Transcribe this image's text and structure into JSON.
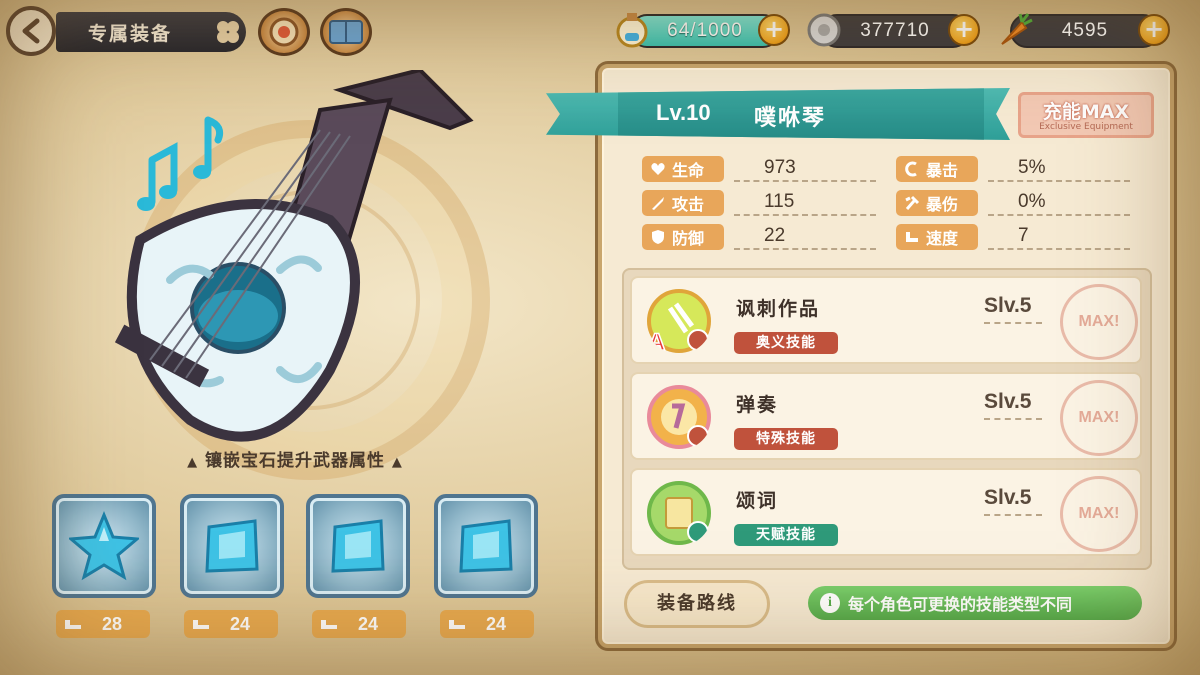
{
  "header": {
    "title": "专属装备",
    "resources": {
      "energy": "64/1000",
      "coins": "377710",
      "carrots": "4595"
    }
  },
  "weapon": {
    "level": "Lv.10",
    "name": "噗咻琴",
    "max_badge": "充能MAX",
    "max_badge_sub": "Exclusive Equipment",
    "gem_caption": "镶嵌宝石提升武器属性",
    "gems": [
      {
        "count": "28"
      },
      {
        "count": "24"
      },
      {
        "count": "24"
      },
      {
        "count": "24"
      }
    ]
  },
  "stats": {
    "hp": {
      "label": "生命",
      "value": "973"
    },
    "atk": {
      "label": "攻击",
      "value": "115"
    },
    "def": {
      "label": "防御",
      "value": "22"
    },
    "crit": {
      "label": "暴击",
      "value": "5%"
    },
    "crit_dmg": {
      "label": "暴伤",
      "value": "0%"
    },
    "speed": {
      "label": "速度",
      "value": "7"
    }
  },
  "skills": [
    {
      "name": "讽刺作品",
      "type": "奥义技能",
      "level": "Slv.5",
      "stamp": "MAX!",
      "type_color": "#c0523c"
    },
    {
      "name": "弹奏",
      "type": "特殊技能",
      "level": "Slv.5",
      "stamp": "MAX!",
      "type_color": "#c0523c"
    },
    {
      "name": "颂词",
      "type": "天赋技能",
      "level": "Slv.5",
      "stamp": "MAX!",
      "type_color": "#2f9a7a"
    }
  ],
  "footer": {
    "route_button": "装备路线",
    "tip": "每个角色可更换的技能类型不同"
  },
  "colors": {
    "accent_teal": "#2f9f98",
    "stat_orange": "#e8a65a",
    "gem_count_bg": "#e7a94f",
    "tip_green": "#54a94a"
  }
}
